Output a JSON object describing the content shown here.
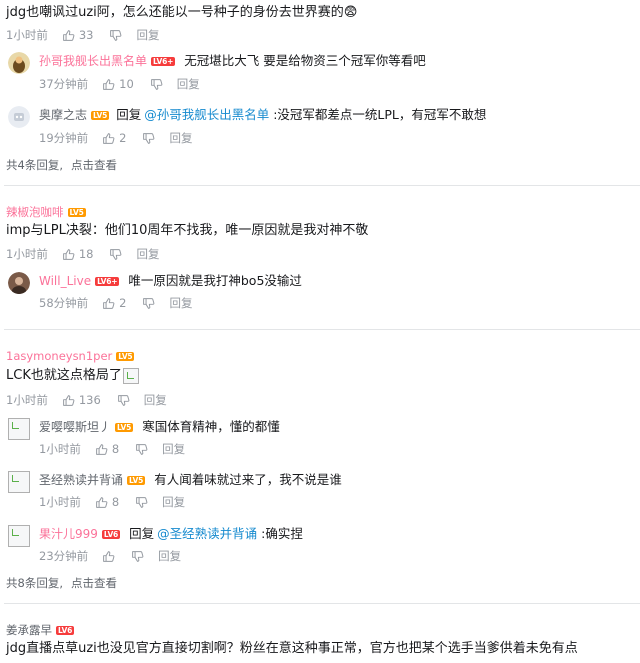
{
  "colors": {
    "pink_name": "#fb7299",
    "meta_gray": "#9499a0",
    "mention_blue": "#178bcf",
    "lv5": "#ff9a00",
    "lv6": "#f63c3c"
  },
  "thread1": {
    "text": "jdg也嘲讽过uzi阿，怎么还能以一号种子的身份去世界赛的",
    "emoji": "😨",
    "time": "1小时前",
    "likes": "33",
    "reply": "回复",
    "replies": [
      {
        "user": "孙哥我舰长出黑名单",
        "level": "LV6+",
        "text": "无冠堪比大飞 要是给物资三个冠军你等看吧",
        "time": "37分钟前",
        "likes": "10",
        "reply": "回复"
      },
      {
        "user": "奥摩之志",
        "level": "LV5",
        "reply_prefix": "回复",
        "mention": "@孙哥我舰长出黑名单",
        "text": ":没冠军都差点一统LPL，有冠军不敢想",
        "time": "19分钟前",
        "likes": "2",
        "reply": "回复"
      }
    ],
    "footer_count": "共4条回复,",
    "footer_see": "点击查看"
  },
  "thread2": {
    "user": "辣椒泡咖啡",
    "level": "LV5",
    "text": "imp与LPL决裂：他们10周年不找我，唯一原因就是我对神不敬",
    "time": "1小时前",
    "likes": "18",
    "reply": "回复",
    "replies": [
      {
        "user": "Will_Live",
        "level": "LV6+",
        "text": "唯一原因就是我打神bo5没输过",
        "time": "58分钟前",
        "likes": "2",
        "reply": "回复"
      }
    ]
  },
  "thread3": {
    "user": "1asymoneysn1per",
    "level": "LV5",
    "text": "LCK也就这点格局了",
    "time": "1小时前",
    "likes": "136",
    "reply": "回复",
    "replies": [
      {
        "user": "爱嘤嘤斯坦丿",
        "level": "LV5",
        "text": "寒国体育精神，懂的都懂",
        "time": "1小时前",
        "likes": "8",
        "reply": "回复"
      },
      {
        "user": "圣经熟读并背诵",
        "level": "LV5",
        "text": "有人闻着味就过来了，我不说是谁",
        "time": "1小时前",
        "likes": "8",
        "reply": "回复"
      },
      {
        "user": "果汁儿999",
        "level": "LV6",
        "reply_prefix": "回复",
        "mention": "@圣经熟读并背诵",
        "text": ":确实捏",
        "time": "23分钟前",
        "likes": "",
        "reply": "回复"
      }
    ],
    "footer_count": "共8条回复,",
    "footer_see": "点击查看"
  },
  "thread4": {
    "user": "姜承露早",
    "level": "LV6",
    "text": "jdg直播点草uzi也没见官方直接切割啊？粉丝在意这种事正常，官方也把某个选手当爹供着未免有点"
  }
}
